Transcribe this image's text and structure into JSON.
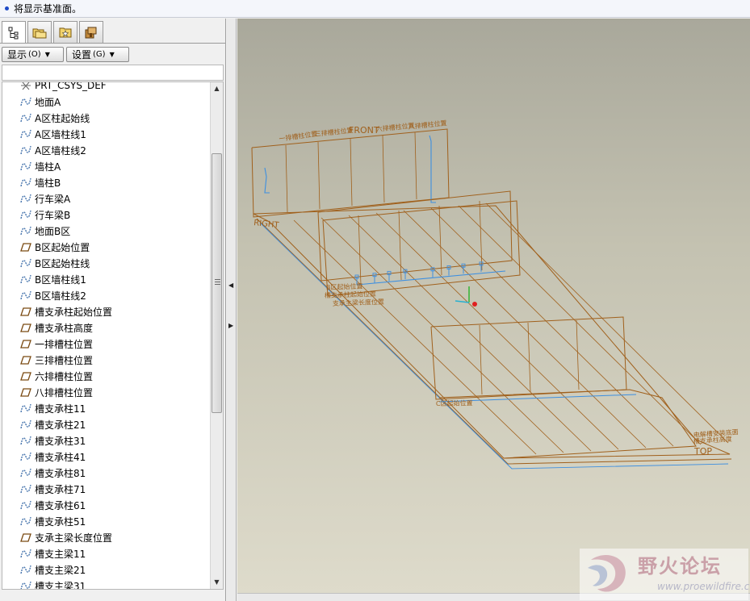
{
  "message": {
    "text": "将显示基准面。"
  },
  "tabs": [
    {
      "icon": "model-tree-icon"
    },
    {
      "icon": "folder-browser-icon"
    },
    {
      "icon": "favorites-icon"
    },
    {
      "icon": "connections-icon"
    }
  ],
  "toolbar": {
    "show": {
      "label": "显示",
      "mnemonic": "(O)"
    },
    "settings": {
      "label": "设置",
      "mnemonic": "(G)"
    }
  },
  "tree": {
    "items": [
      {
        "label": "PRT_CSYS_DEF",
        "icon": "csys"
      },
      {
        "label": "地面A",
        "icon": "curve"
      },
      {
        "label": "A区柱起始线",
        "icon": "curve"
      },
      {
        "label": "A区墙柱线1",
        "icon": "curve"
      },
      {
        "label": "A区墙柱线2",
        "icon": "curve"
      },
      {
        "label": "墙柱A",
        "icon": "curve"
      },
      {
        "label": "墙柱B",
        "icon": "curve"
      },
      {
        "label": "行车梁A",
        "icon": "curve"
      },
      {
        "label": "行车梁B",
        "icon": "curve"
      },
      {
        "label": "地面B区",
        "icon": "curve"
      },
      {
        "label": "B区起始位置",
        "icon": "plane"
      },
      {
        "label": "B区起始柱线",
        "icon": "curve"
      },
      {
        "label": "B区墙柱线1",
        "icon": "curve"
      },
      {
        "label": "B区墙柱线2",
        "icon": "curve"
      },
      {
        "label": "槽支承柱起始位置",
        "icon": "plane"
      },
      {
        "label": "槽支承柱高度",
        "icon": "plane"
      },
      {
        "label": "一排槽柱位置",
        "icon": "plane"
      },
      {
        "label": "三排槽柱位置",
        "icon": "plane"
      },
      {
        "label": "六排槽柱位置",
        "icon": "plane"
      },
      {
        "label": "八排槽柱位置",
        "icon": "plane"
      },
      {
        "label": "槽支承柱11",
        "icon": "curve"
      },
      {
        "label": "槽支承柱21",
        "icon": "curve"
      },
      {
        "label": "槽支承柱31",
        "icon": "curve"
      },
      {
        "label": "槽支承柱41",
        "icon": "curve"
      },
      {
        "label": "槽支承柱81",
        "icon": "curve"
      },
      {
        "label": "槽支承柱71",
        "icon": "curve"
      },
      {
        "label": "槽支承柱61",
        "icon": "curve"
      },
      {
        "label": "槽支承柱51",
        "icon": "curve"
      },
      {
        "label": "支承主梁长度位置",
        "icon": "plane"
      },
      {
        "label": "槽支主梁11",
        "icon": "curve"
      },
      {
        "label": "槽支主梁21",
        "icon": "curve"
      },
      {
        "label": "槽支主梁31",
        "icon": "curve"
      }
    ]
  },
  "viewport": {
    "labels": {
      "front": "FRONT",
      "right": "RIGHT",
      "top": "TOP",
      "row1": "一排槽柱位置",
      "row3": "三排槽柱位置",
      "row6": "六排槽柱位置",
      "row8": "八排槽柱位置",
      "b_start": "B区起始位置",
      "support_start": "槽支承柱起始位置",
      "beam_len": "支承主梁长度位置",
      "c_start": "C区起始位置",
      "elec_bottom": "电解槽安装底面",
      "support_height": "槽支承柱高度"
    },
    "colors": {
      "datum": "#a0601c",
      "curve": "#3d8fe0",
      "bg_top": "#a9a89b",
      "bg_bottom": "#dedbcb"
    }
  },
  "watermark": {
    "title": "野火论坛",
    "url": "www.proewildfire.cn"
  }
}
